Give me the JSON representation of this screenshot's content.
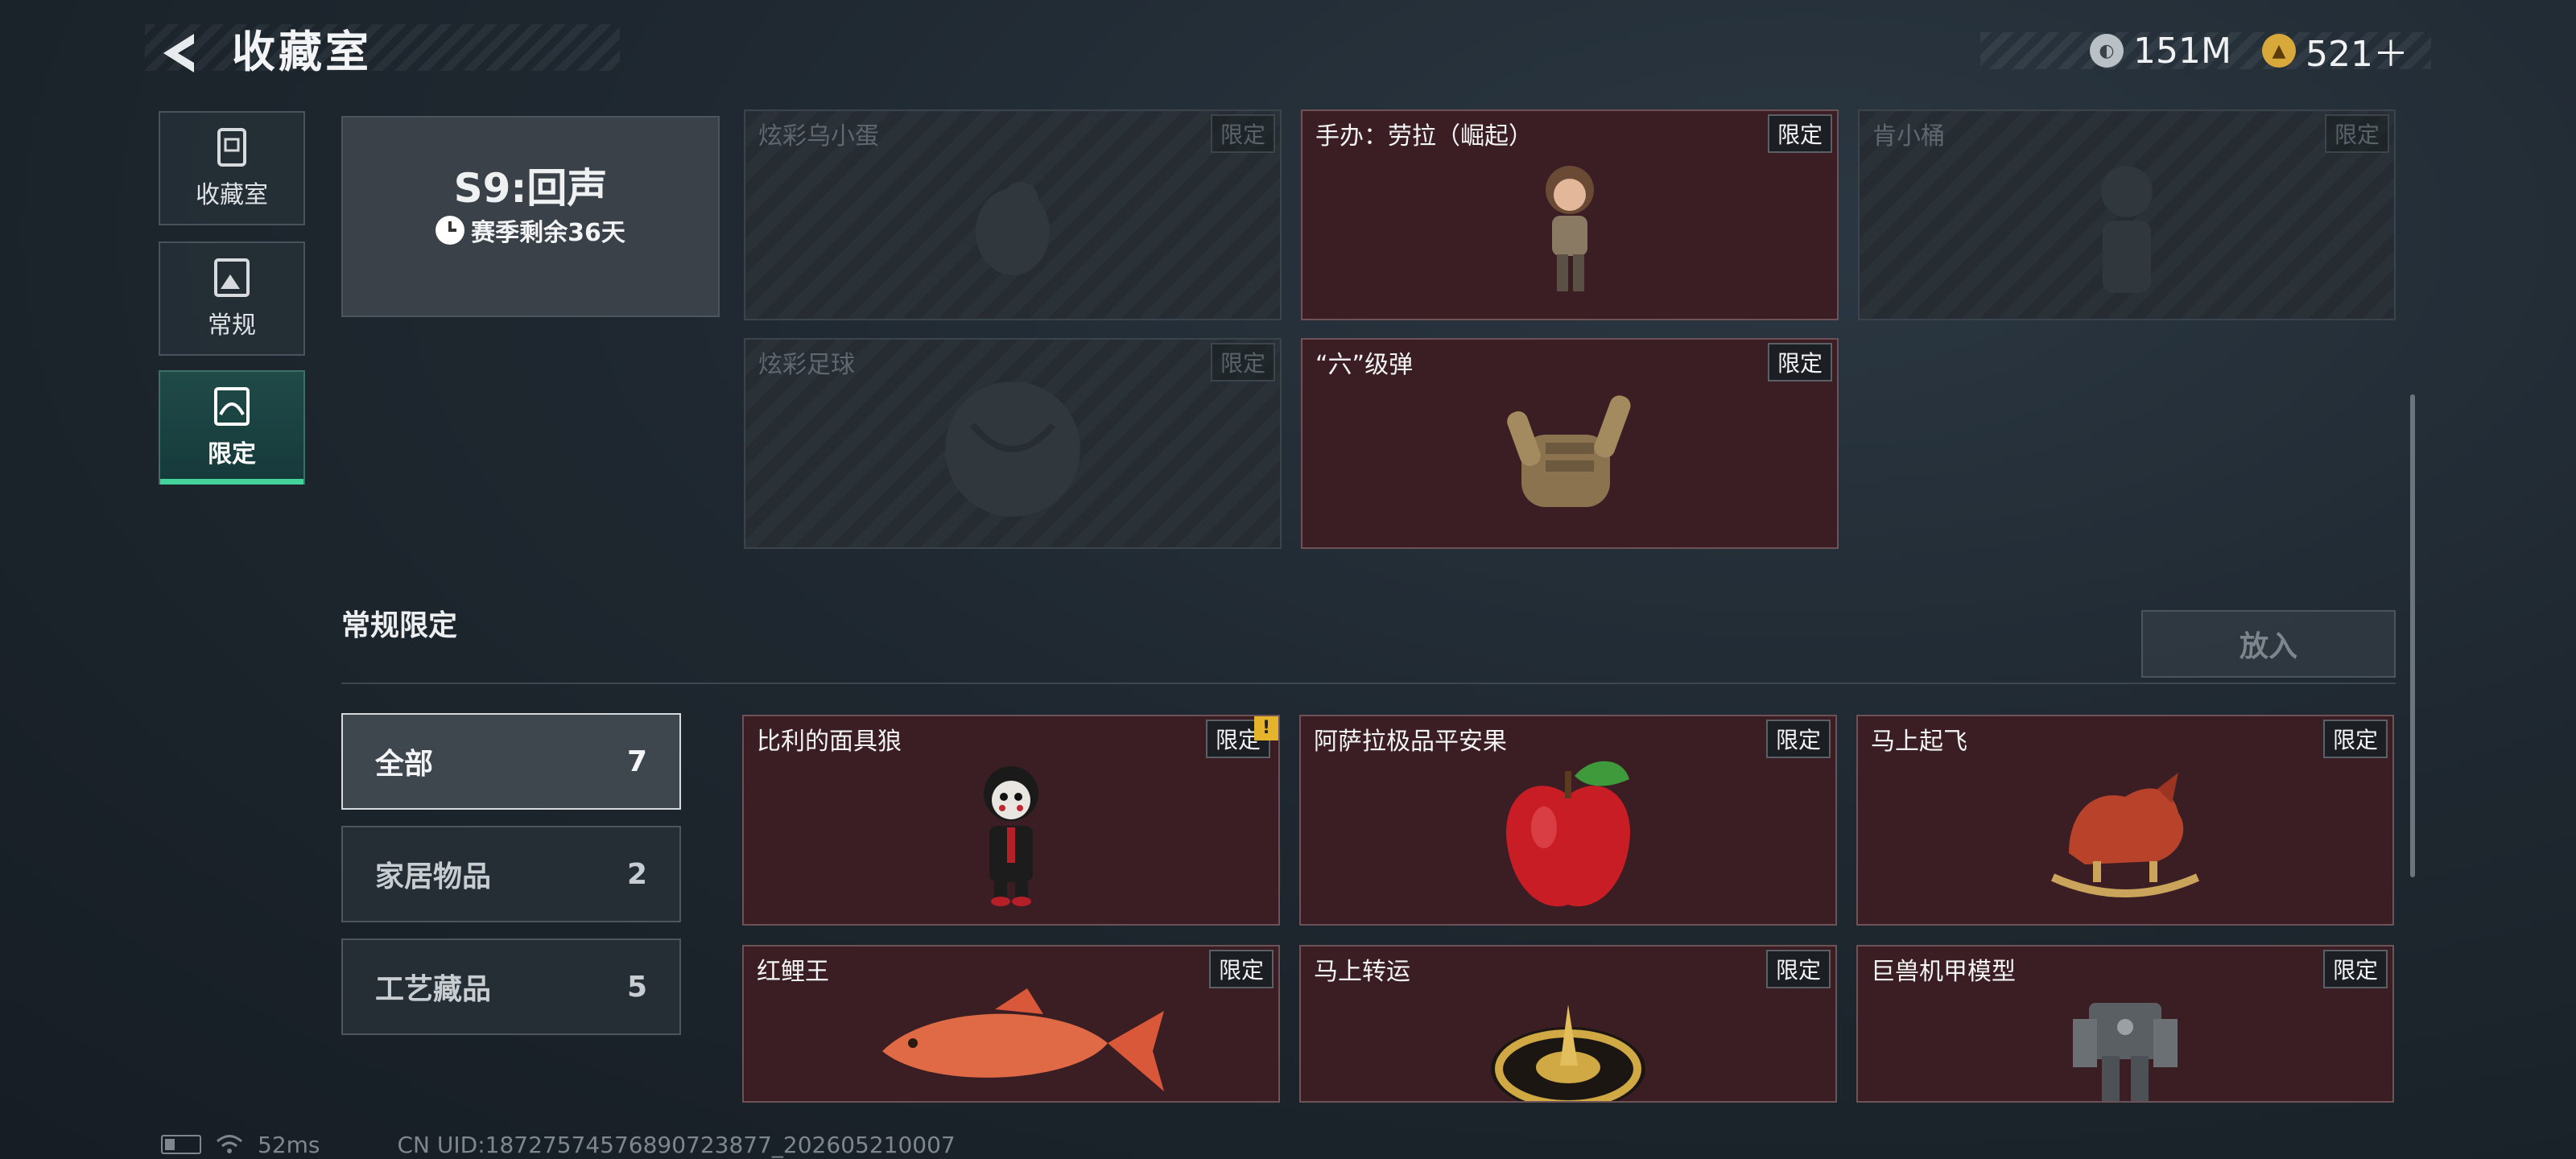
{
  "header": {
    "title": "收藏室",
    "currency_primary": "151M",
    "currency_secondary": "521＋"
  },
  "nav": {
    "tabs": [
      {
        "label": "收藏室",
        "icon": "collection-icon"
      },
      {
        "label": "常规",
        "icon": "picture-frame-icon"
      },
      {
        "label": "限定",
        "icon": "limited-icon",
        "active": true
      }
    ]
  },
  "season": {
    "title": "S9:回声",
    "remaining": "赛季剩余36天"
  },
  "season_items": [
    {
      "name": "炫彩乌小蛋",
      "tag": "限定",
      "owned": false
    },
    {
      "name": "手办：劳拉（崛起）",
      "tag": "限定",
      "owned": true
    },
    {
      "name": "肯小桶",
      "tag": "限定",
      "owned": false
    },
    {
      "name": "炫彩足球",
      "tag": "限定",
      "owned": false
    },
    {
      "name": "“六”级弹",
      "tag": "限定",
      "owned": true
    }
  ],
  "section": {
    "title": "常规限定",
    "put_button": "放入"
  },
  "filters": [
    {
      "label": "全部",
      "count": "7",
      "active": true
    },
    {
      "label": "家居物品",
      "count": "2"
    },
    {
      "label": "工艺藏品",
      "count": "5"
    }
  ],
  "regular_items": [
    {
      "name": "比利的面具狼",
      "tag": "限定",
      "notice": "!"
    },
    {
      "name": "阿萨拉极品平安果",
      "tag": "限定"
    },
    {
      "name": "马上起飞",
      "tag": "限定"
    },
    {
      "name": "红鲤王",
      "tag": "限定"
    },
    {
      "name": "马上转运",
      "tag": "限定"
    },
    {
      "name": "巨兽机甲模型",
      "tag": "限定"
    }
  ],
  "footer": {
    "ping": "52ms",
    "uid": "CN UID:18727574576890723877_202605210007"
  },
  "colors": {
    "accent_green": "#44d39a",
    "card_red": "#3a1e23",
    "notice_yellow": "#e5b42a"
  }
}
